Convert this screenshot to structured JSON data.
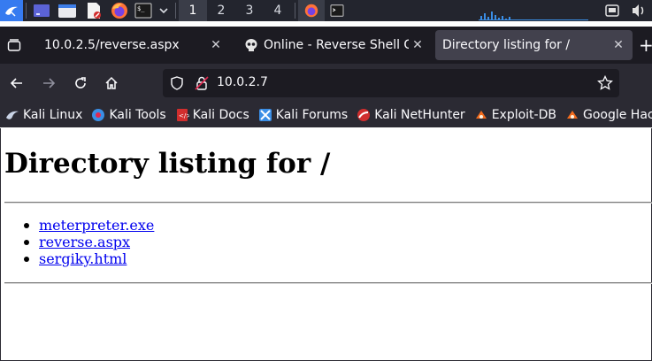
{
  "taskbar": {
    "workspaces": [
      "1",
      "2",
      "3",
      "4"
    ],
    "active_workspace": "1"
  },
  "tabs": [
    {
      "title": "10.0.2.5/reverse.aspx",
      "selected": false,
      "icon": "none"
    },
    {
      "title": "Online - Reverse Shell Ge",
      "selected": false,
      "icon": "skull-icon"
    },
    {
      "title": "Directory listing for /",
      "selected": true,
      "icon": "none"
    }
  ],
  "new_tab_label": "+",
  "navbar": {
    "url": "10.0.2.7"
  },
  "bookmarks": [
    {
      "label": "Kali Linux",
      "icon": "kali-dragon-icon"
    },
    {
      "label": "Kali Tools",
      "icon": "kali-tools-icon"
    },
    {
      "label": "Kali Docs",
      "icon": "kali-docs-icon"
    },
    {
      "label": "Kali Forums",
      "icon": "kali-forums-icon"
    },
    {
      "label": "Kali NetHunter",
      "icon": "nethunter-icon"
    },
    {
      "label": "Exploit-DB",
      "icon": "exploit-db-icon"
    },
    {
      "label": "Google Hacki",
      "icon": "google-hacking-icon"
    }
  ],
  "page": {
    "heading": "Directory listing for /",
    "files": [
      "meterpreter.exe",
      "reverse.aspx",
      "sergiky.html"
    ],
    "link_color": "#0000ee"
  },
  "colors": {
    "taskbar_bg": "#23252e",
    "tabstrip_bg": "#1c1b22",
    "toolbar_bg": "#2b2a33",
    "selected_tab_bg": "#42414d",
    "kali_blue": "#3a8ee6"
  }
}
